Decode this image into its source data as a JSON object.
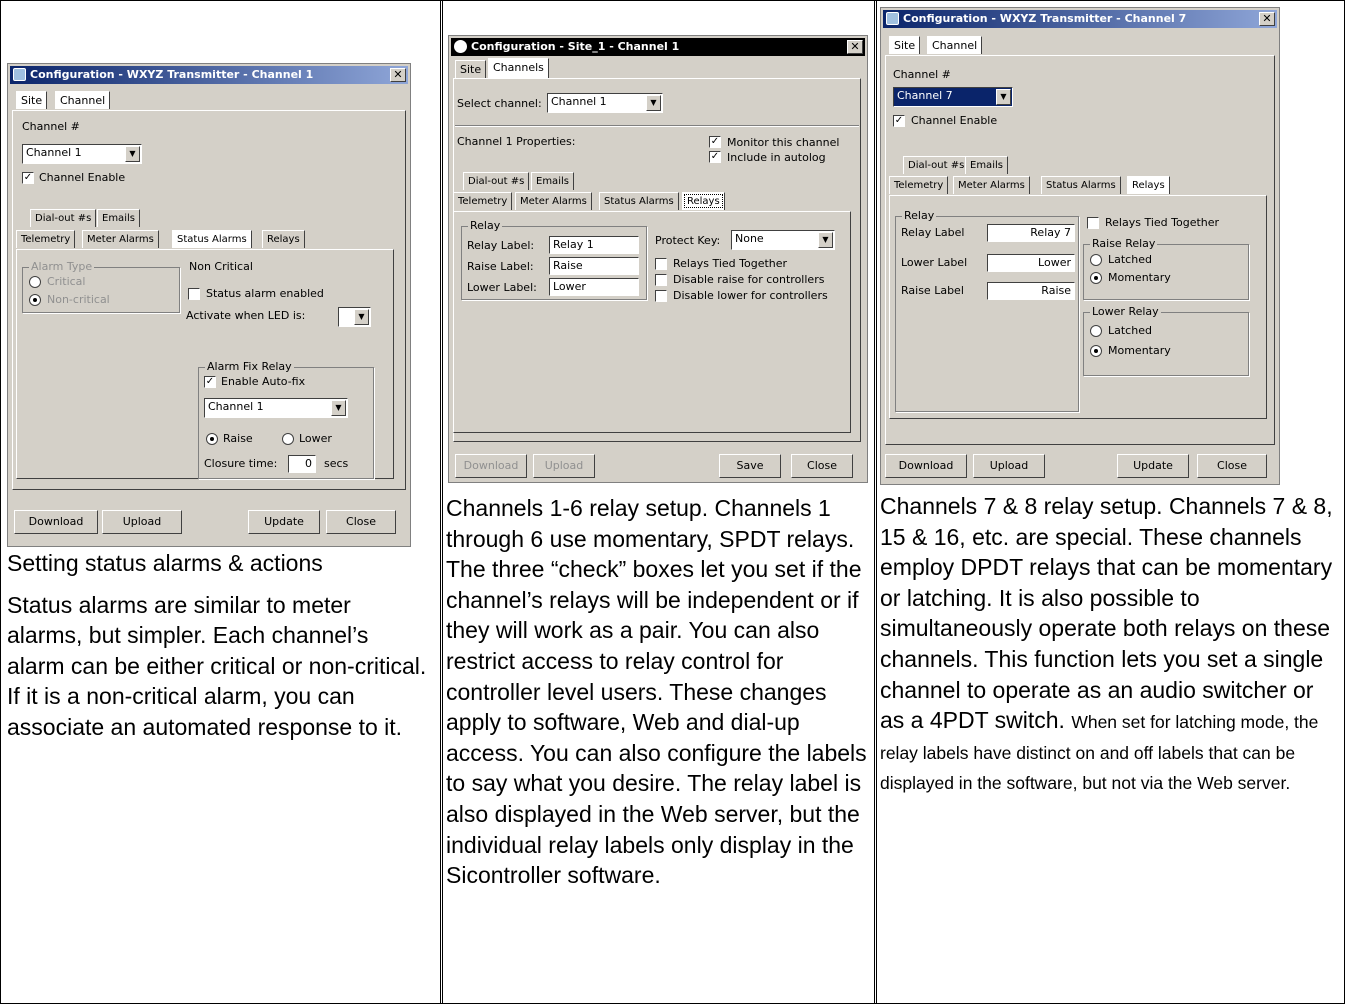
{
  "col1": {
    "dialog": {
      "title": "Configuration - WXYZ Transmitter - Channel 1",
      "tabs": [
        "Site",
        "Channel"
      ],
      "channel_label": "Channel #",
      "channel_value": "Channel 1",
      "channel_enable": "Channel Enable",
      "subtabs_row1": [
        "Dial-out #s",
        "Emails"
      ],
      "subtabs_row2": [
        "Telemetry",
        "Meter Alarms",
        "Status Alarms",
        "Relays"
      ],
      "alarm_type_title": "Alarm Type",
      "alarm_type_opts": [
        "Critical",
        "Non-critical"
      ],
      "noncritical_title": "Non Critical",
      "status_alarm_enabled": "Status alarm enabled",
      "activate_led": "Activate when LED is:",
      "alarm_fix_title": "Alarm Fix Relay",
      "enable_autofix": "Enable Auto-fix",
      "fix_channel": "Channel 1",
      "raise": "Raise",
      "lower": "Lower",
      "closure_time": "Closure time:",
      "closure_value": "0",
      "secs": "secs",
      "buttons": [
        "Download",
        "Upload",
        "Update",
        "Close"
      ]
    },
    "caption_title": "Setting status alarms & actions",
    "caption_body": "Status alarms are similar to meter alarms, but simpler.  Each channel’s alarm can be either critical or non-critical.  If it is a non-critical alarm, you can associate an automated response to it."
  },
  "col2": {
    "dialog": {
      "title": "Configuration - Site_1 - Channel 1",
      "tabs": [
        "Site",
        "Channels"
      ],
      "select_channel_label": "Select channel:",
      "select_channel_value": "Channel 1",
      "properties_label": "Channel 1 Properties:",
      "monitor": "Monitor this channel",
      "include": "Include in autolog",
      "subtabs_row1": [
        "Dial-out #s",
        "Emails"
      ],
      "subtabs_row2": [
        "Telemetry",
        "Meter Alarms",
        "Status Alarms",
        "Relays"
      ],
      "relay_group_title": "Relay",
      "relay_label": "Relay Label:",
      "relay_value": "Relay 1",
      "raise_label": "Raise Label:",
      "raise_value": "Raise",
      "lower_label": "Lower Label:",
      "lower_value": "Lower",
      "protect_key": "Protect Key:",
      "protect_value": "None",
      "tied": "Relays Tied Together",
      "disable_raise": "Disable raise for controllers",
      "disable_lower": "Disable lower for controllers",
      "buttons": [
        "Download",
        "Upload",
        "Save",
        "Close"
      ]
    },
    "caption": "Channels 1-6 relay setup.  Channels 1 through 6 use momentary, SPDT relays. The three “check” boxes let you set if the channel’s relays will be independent or if they will work as a pair.    You can also restrict access to relay control for controller level users.  These changes apply to software, Web and dial-up access.  You can also configure the labels to say what you desire.  The relay label is also displayed in the Web server, but the individual relay labels only display in the Sicontroller software."
  },
  "col3": {
    "dialog": {
      "title": "Configuration - WXYZ Transmitter - Channel 7",
      "tabs": [
        "Site",
        "Channel"
      ],
      "channel_label": "Channel #",
      "channel_value": "Channel 7",
      "channel_enable": "Channel Enable",
      "subtabs_row1": [
        "Dial-out #s",
        "Emails"
      ],
      "subtabs_row2": [
        "Telemetry",
        "Meter Alarms",
        "Status Alarms",
        "Relays"
      ],
      "relay_group_title": "Relay",
      "relay_label": "Relay Label",
      "relay_value": "Relay 7",
      "lower_label": "Lower Label",
      "lower_value": "Lower",
      "raise_label": "Raise Label",
      "raise_value": "Raise",
      "tied": "Relays Tied Together",
      "raise_relay_title": "Raise Relay",
      "lower_relay_title": "Lower Relay",
      "latched": "Latched",
      "momentary": "Momentary",
      "buttons": [
        "Download",
        "Upload",
        "Update",
        "Close"
      ]
    },
    "caption_main": "Channels 7 & 8 relay setup.  Channels 7 & 8, 15 & 16, etc. are special.  These channels employ DPDT relays that can be momentary or latching.  It is also possible to simultaneously operate both relays on these channels.  This function lets you set a single channel to operate as an audio switcher or as a 4PDT switch.",
    "caption_small": "When set for latching mode, the relay labels have distinct on and off labels that can be displayed in the software, but not via the Web server."
  }
}
